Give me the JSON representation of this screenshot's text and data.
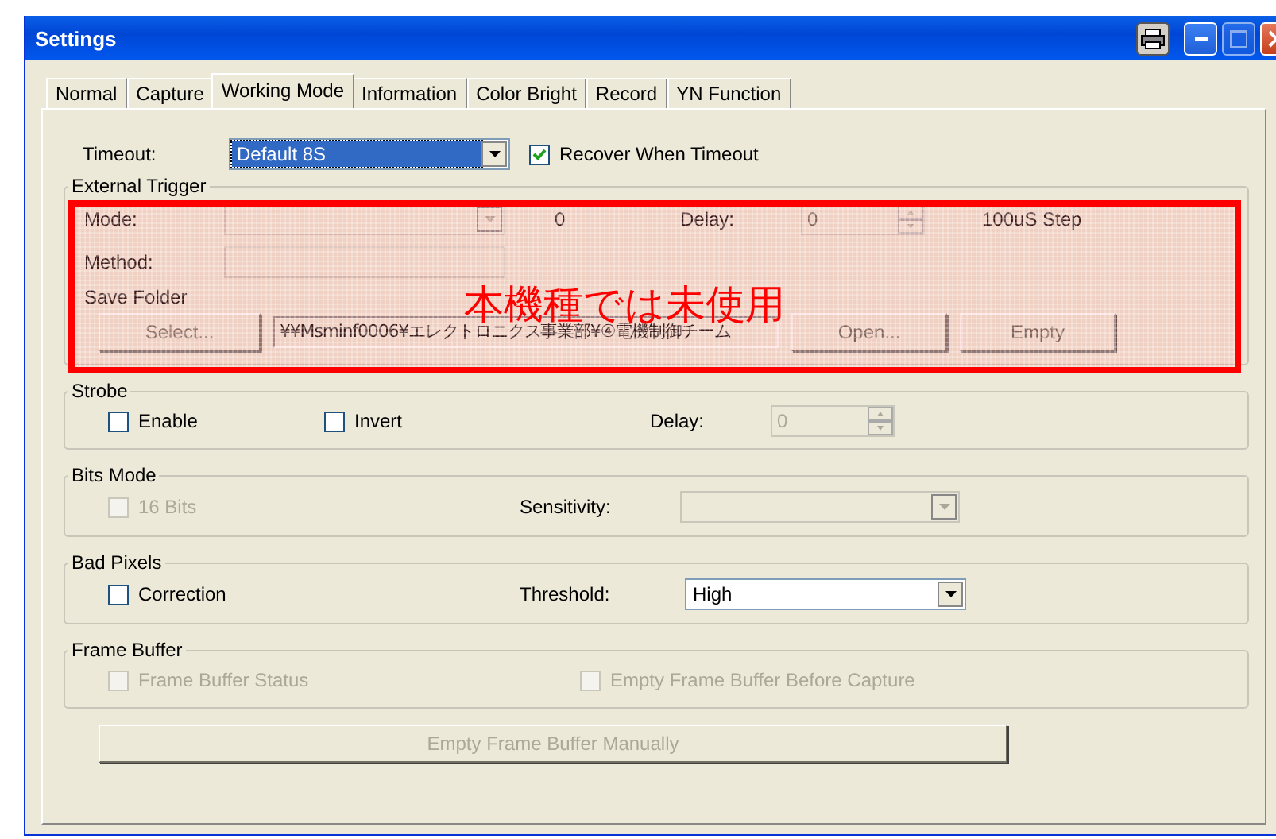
{
  "window": {
    "title": "Settings"
  },
  "tabs": [
    {
      "label": "Normal",
      "selected": false
    },
    {
      "label": "Capture",
      "selected": false
    },
    {
      "label": "Working Mode",
      "selected": true
    },
    {
      "label": "Information",
      "selected": false
    },
    {
      "label": "Color Bright",
      "selected": false
    },
    {
      "label": "Record",
      "selected": false
    },
    {
      "label": "YN Function",
      "selected": false
    }
  ],
  "timeout": {
    "label": "Timeout:",
    "value": "Default 8S",
    "highlighted": true
  },
  "recover": {
    "label": "Recover When Timeout",
    "checked": true,
    "disabled": false
  },
  "external_trigger": {
    "title": "External Trigger",
    "mode_label": "Mode:",
    "mode_value": "0",
    "delay_label": "Delay:",
    "delay_value": "0",
    "delay_unit": "100uS Step",
    "method_label": "Method:",
    "save_folder_label": "Save Folder",
    "path": "¥¥Msminf0006¥エレクトロニクス事業部¥④電機制御チーム",
    "buttons": [
      {
        "label": "Select...",
        "disabled": true
      },
      {
        "label": "Open...",
        "disabled": true
      },
      {
        "label": "Empty",
        "disabled": true
      }
    ],
    "annotation": "本機種では未使用"
  },
  "strobe": {
    "title": "Strobe",
    "enable": {
      "label": "Enable",
      "checked": false,
      "disabled": false
    },
    "invert": {
      "label": "Invert",
      "checked": false,
      "disabled": false
    },
    "delay_label": "Delay:",
    "delay_value": "0",
    "delay_disabled": true
  },
  "bits_mode": {
    "title": "Bits Mode",
    "bits16": {
      "label": "16 Bits",
      "checked": false,
      "disabled": true
    },
    "sensitivity_label": "Sensitivity:",
    "sensitivity_disabled": true
  },
  "bad_pixels": {
    "title": "Bad Pixels",
    "correction": {
      "label": "Correction",
      "checked": false,
      "disabled": false
    },
    "threshold_label": "Threshold:",
    "threshold_value": "High"
  },
  "frame_buffer": {
    "title": "Frame Buffer",
    "status": {
      "label": "Frame Buffer Status",
      "checked": false,
      "disabled": true
    },
    "empty_before": {
      "label": "Empty Frame Buffer Before Capture",
      "checked": false,
      "disabled": true
    }
  },
  "empty_manually": {
    "label": "Empty Frame Buffer Manually",
    "disabled": true
  }
}
